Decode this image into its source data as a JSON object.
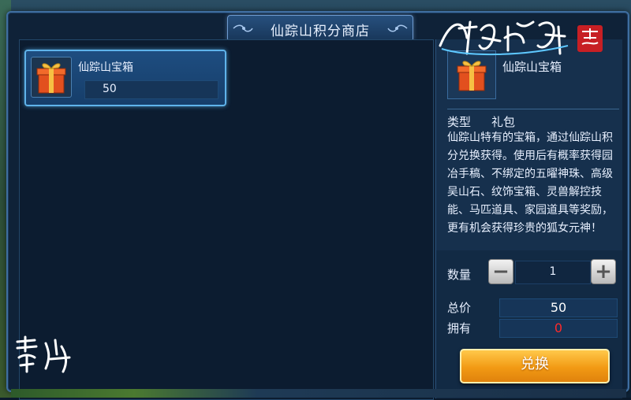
{
  "shop": {
    "title": "仙踪山积分商店"
  },
  "items": [
    {
      "name": "仙踪山宝箱",
      "price": "50",
      "icon": "gift-box-icon"
    }
  ],
  "detail": {
    "name": "仙踪山宝箱",
    "type_label": "类型",
    "type_value": "礼包",
    "description": "仙踪山特有的宝箱，通过仙踪山积分兑换获得。使用后有概率获得园冶手稿、不绑定的五曜神珠、高级吴山石、纹饰宝箱、灵兽解控技能、马匹道具、家园道具等奖励，更有机会获得珍贵的狐女元神！",
    "icon": "gift-box-icon"
  },
  "purchase": {
    "quantity_label": "数量",
    "quantity": "1",
    "minus_symbol": "−",
    "plus_symbol": "+",
    "total_label": "总价",
    "total": "50",
    "owned_label": "拥有",
    "owned": "0",
    "exchange_label": "兑换"
  },
  "branding": {
    "game_logo": "倩女幽魂 手游",
    "watermark": "雷火"
  },
  "colors": {
    "accent_border": "#5fb3ea",
    "exchange_button": "#f29a14",
    "owned_zero": "#ff2a2a"
  }
}
